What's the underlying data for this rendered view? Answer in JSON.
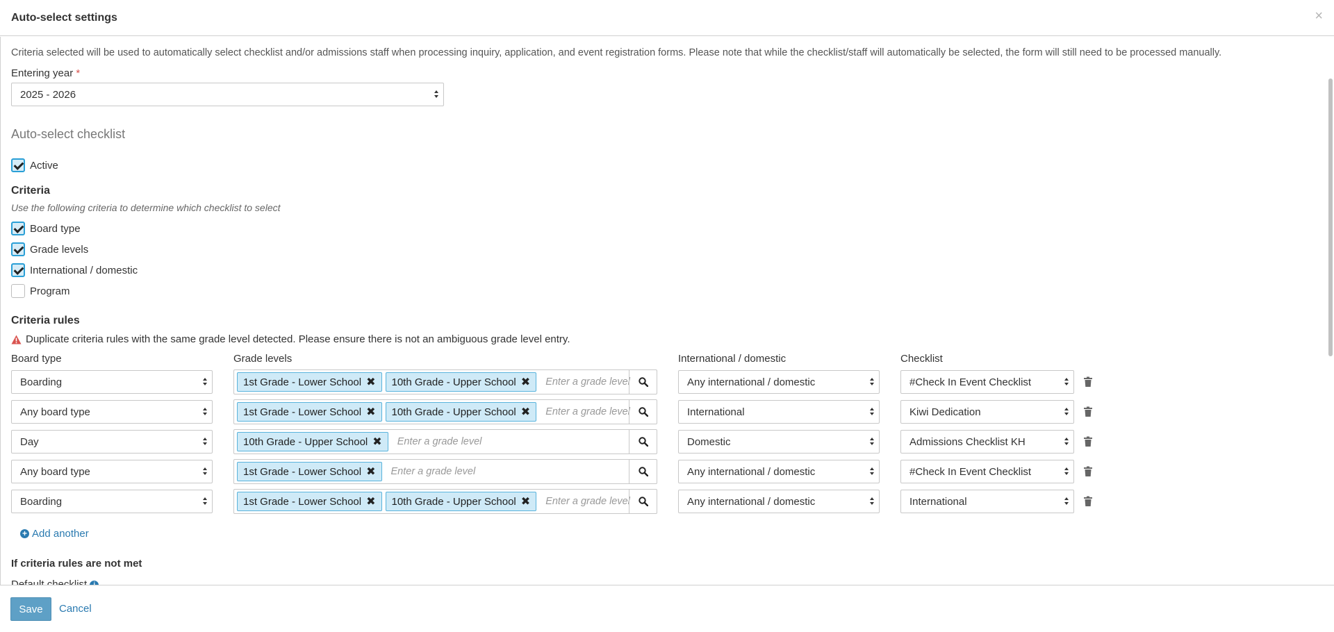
{
  "dialog": {
    "title": "Auto-select settings",
    "close_icon": "×"
  },
  "intro": "Criteria selected will be used to automatically select checklist and/or admissions staff when processing inquiry, application, and event registration forms. Please note that while the checklist/staff will automatically be selected, the form will still need to be processed manually.",
  "entering_year": {
    "label": "Entering year",
    "required_mark": "*",
    "value": "2025 - 2026"
  },
  "auto_select_checklist": {
    "heading": "Auto-select checklist",
    "active_label": "Active",
    "active_checked": true
  },
  "criteria": {
    "heading": "Criteria",
    "hint": "Use the following criteria to determine which checklist to select",
    "options": [
      {
        "label": "Board type",
        "checked": true
      },
      {
        "label": "Grade levels",
        "checked": true
      },
      {
        "label": "International / domestic",
        "checked": true
      },
      {
        "label": "Program",
        "checked": false
      }
    ]
  },
  "criteria_rules": {
    "heading": "Criteria rules",
    "warning": "Duplicate criteria rules with the same grade level detected. Please ensure there is not an ambiguous grade level entry.",
    "columns": {
      "board_type": "Board type",
      "grade_levels": "Grade levels",
      "intl_domestic": "International / domestic",
      "checklist": "Checklist"
    },
    "grade_placeholder": "Enter a grade level",
    "rows": [
      {
        "board_type": "Boarding",
        "grades": [
          "1st Grade - Lower School",
          "10th Grade - Upper School"
        ],
        "intl": "Any international / domestic",
        "checklist": "#Check In Event Checklist"
      },
      {
        "board_type": "Any board type",
        "grades": [
          "1st Grade - Lower School",
          "10th Grade - Upper School"
        ],
        "intl": "International",
        "checklist": "Kiwi Dedication"
      },
      {
        "board_type": "Day",
        "grades": [
          "10th Grade - Upper School"
        ],
        "intl": "Domestic",
        "checklist": "Admissions Checklist KH"
      },
      {
        "board_type": "Any board type",
        "grades": [
          "1st Grade - Lower School"
        ],
        "intl": "Any international / domestic",
        "checklist": "#Check In Event Checklist"
      },
      {
        "board_type": "Boarding",
        "grades": [
          "1st Grade - Lower School",
          "10th Grade - Upper School"
        ],
        "intl": "Any international / domestic",
        "checklist": "International"
      }
    ],
    "add_another": "Add another"
  },
  "not_met": {
    "heading": "If criteria rules are not met",
    "default_checklist_label": "Default checklist"
  },
  "footer": {
    "save": "Save",
    "cancel": "Cancel"
  },
  "colors": {
    "accent": "#2a9fd6",
    "link": "#2a7ab0",
    "save_bg": "#5ea0c6",
    "tag_bg": "#cfeaf7",
    "warning": "#d9534f"
  }
}
